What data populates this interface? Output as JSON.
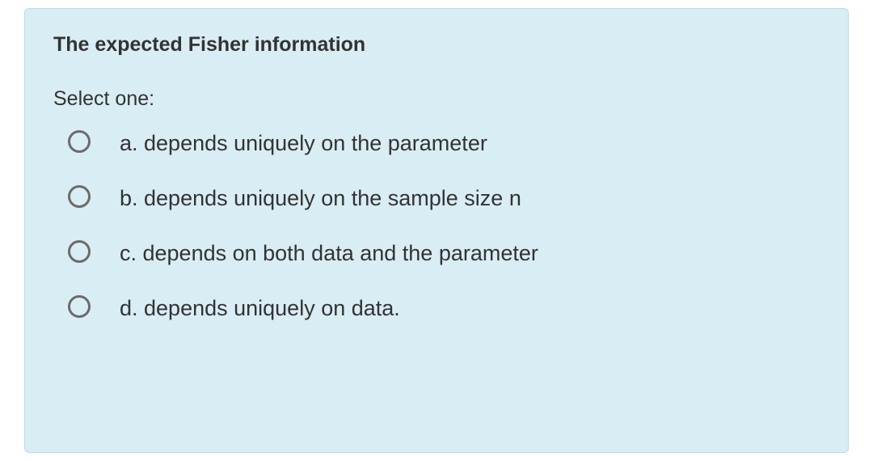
{
  "question": {
    "title": "The expected Fisher information",
    "prompt": "Select one:",
    "options": [
      {
        "label": "a. depends uniquely on the parameter"
      },
      {
        "label": "b. depends uniquely on the sample size n"
      },
      {
        "label": "c. depends on both data and the parameter"
      },
      {
        "label": "d. depends uniquely on data."
      }
    ]
  }
}
